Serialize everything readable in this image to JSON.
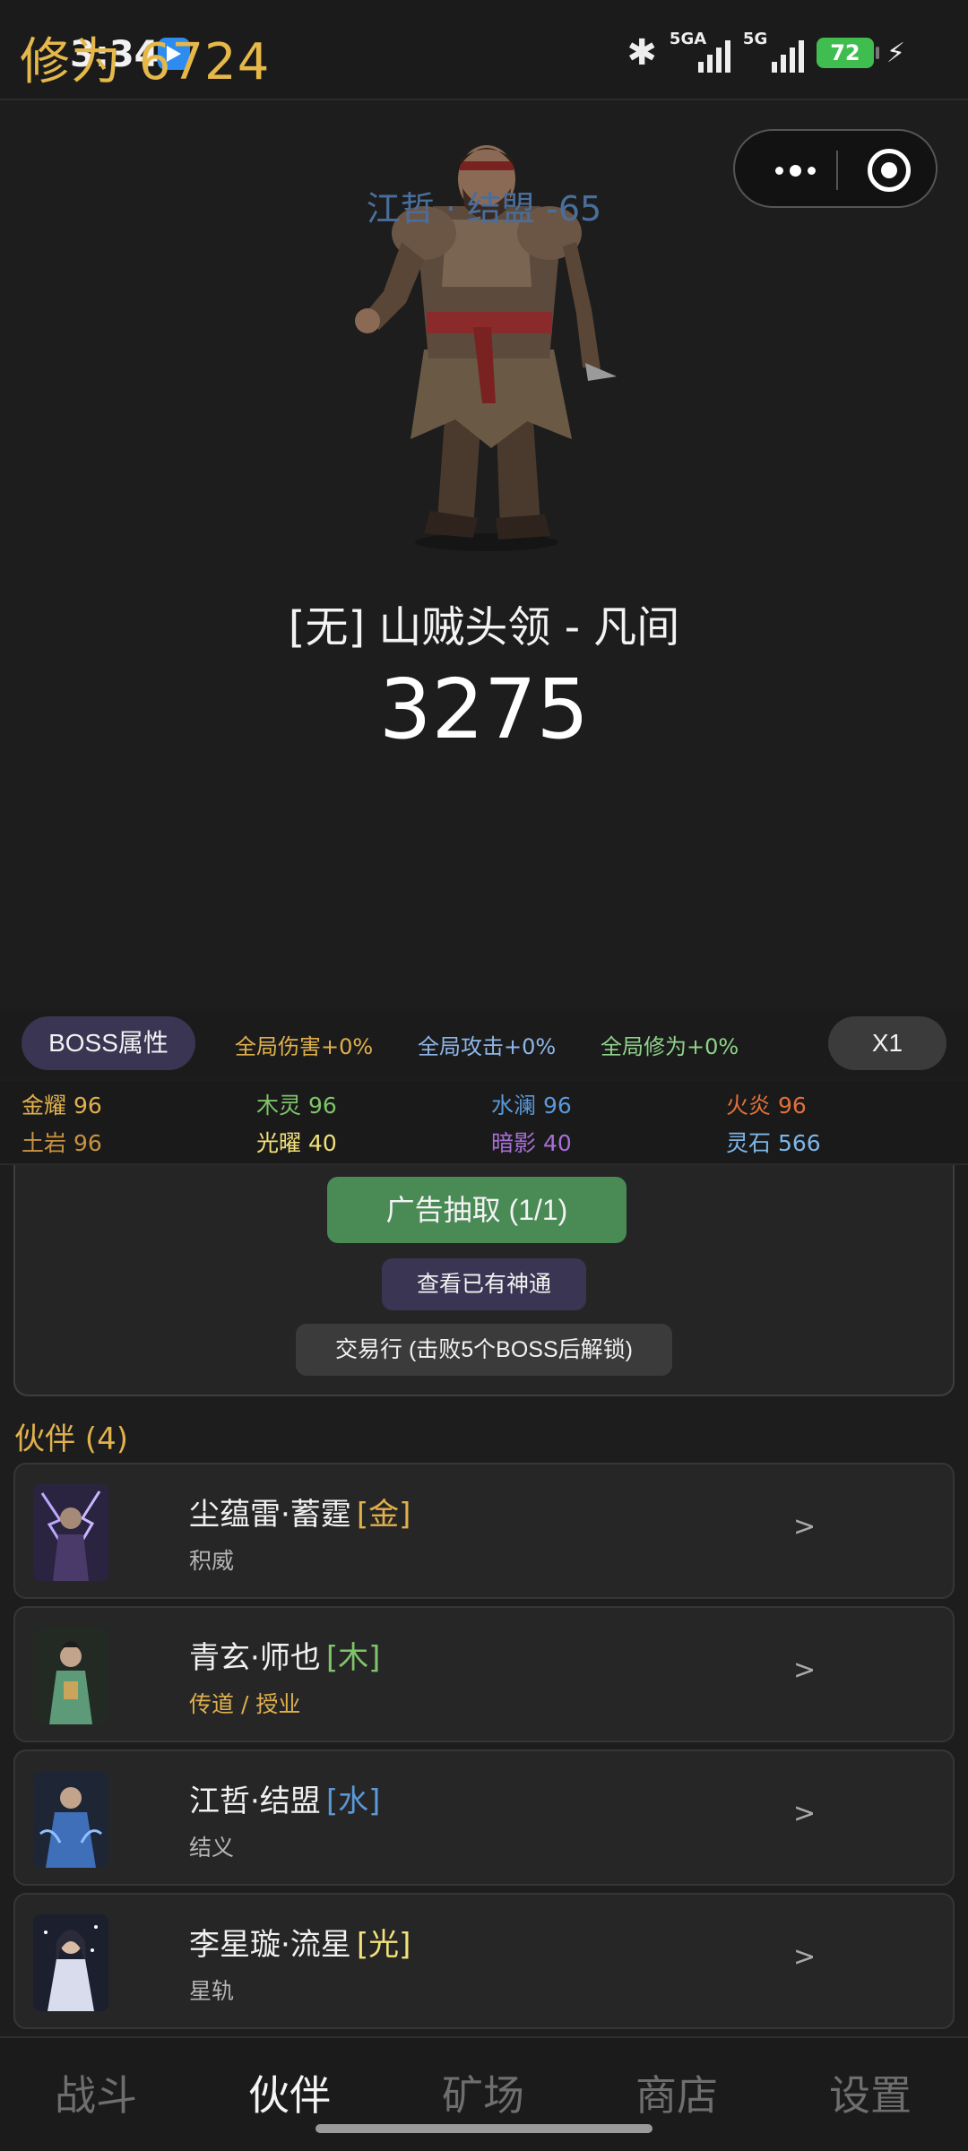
{
  "status_bar": {
    "time": "3:34",
    "overlay_title": "修为 6724",
    "network1": "5GA",
    "network2": "5G",
    "battery": "72"
  },
  "boss": {
    "subtitle": "江哲 · 结盟 -65",
    "name": "[无] 山贼头领 - 凡间",
    "hp": "3275"
  },
  "attr_bar": {
    "boss_attr_label": "BOSS属性",
    "global_damage": "全局伤害+0%",
    "global_attack": "全局攻击+0%",
    "global_cultivation": "全局修为+0%",
    "speed": "X1"
  },
  "elements": [
    {
      "label": "金耀 96",
      "color": "#e0b04d"
    },
    {
      "label": "木灵 96",
      "color": "#7fc46a"
    },
    {
      "label": "水澜 96",
      "color": "#5a98d8"
    },
    {
      "label": "火炎 96",
      "color": "#e0703a"
    },
    {
      "label": "土岩 96",
      "color": "#c9923f"
    },
    {
      "label": "光曜 40",
      "color": "#f3e27a"
    },
    {
      "label": "暗影 40",
      "color": "#a86fd8"
    },
    {
      "label": "灵石 566",
      "color": "#7db6e8"
    }
  ],
  "actions": {
    "ad_draw": "广告抽取 (1/1)",
    "view_skills": "查看已有神通",
    "trade": "交易行 (击败5个BOSS后解锁)"
  },
  "partners": {
    "title": "伙伴 (4)",
    "items": [
      {
        "name": "尘蕴雷·蓄霆",
        "element": "[金]",
        "element_color": "#e0b04d",
        "skill": "积威",
        "skill_color": "#b5b5b5",
        "arrow": ">"
      },
      {
        "name": "青玄·师也",
        "element": "[木]",
        "element_color": "#7fc46a",
        "skill": "传道 / 授业",
        "skill_color": "#e0b04d",
        "arrow": ">"
      },
      {
        "name": "江哲·结盟",
        "element": "[水]",
        "element_color": "#5a98d8",
        "skill": "结义",
        "skill_color": "#b5b5b5",
        "arrow": ">"
      },
      {
        "name": "李星璇·流星",
        "element": "[光]",
        "element_color": "#f3e27a",
        "skill": "星轨",
        "skill_color": "#b5b5b5",
        "arrow": ">"
      }
    ]
  },
  "nav": {
    "items": [
      "战斗",
      "伙伴",
      "矿场",
      "商店",
      "设置"
    ],
    "active": "伙伴"
  }
}
